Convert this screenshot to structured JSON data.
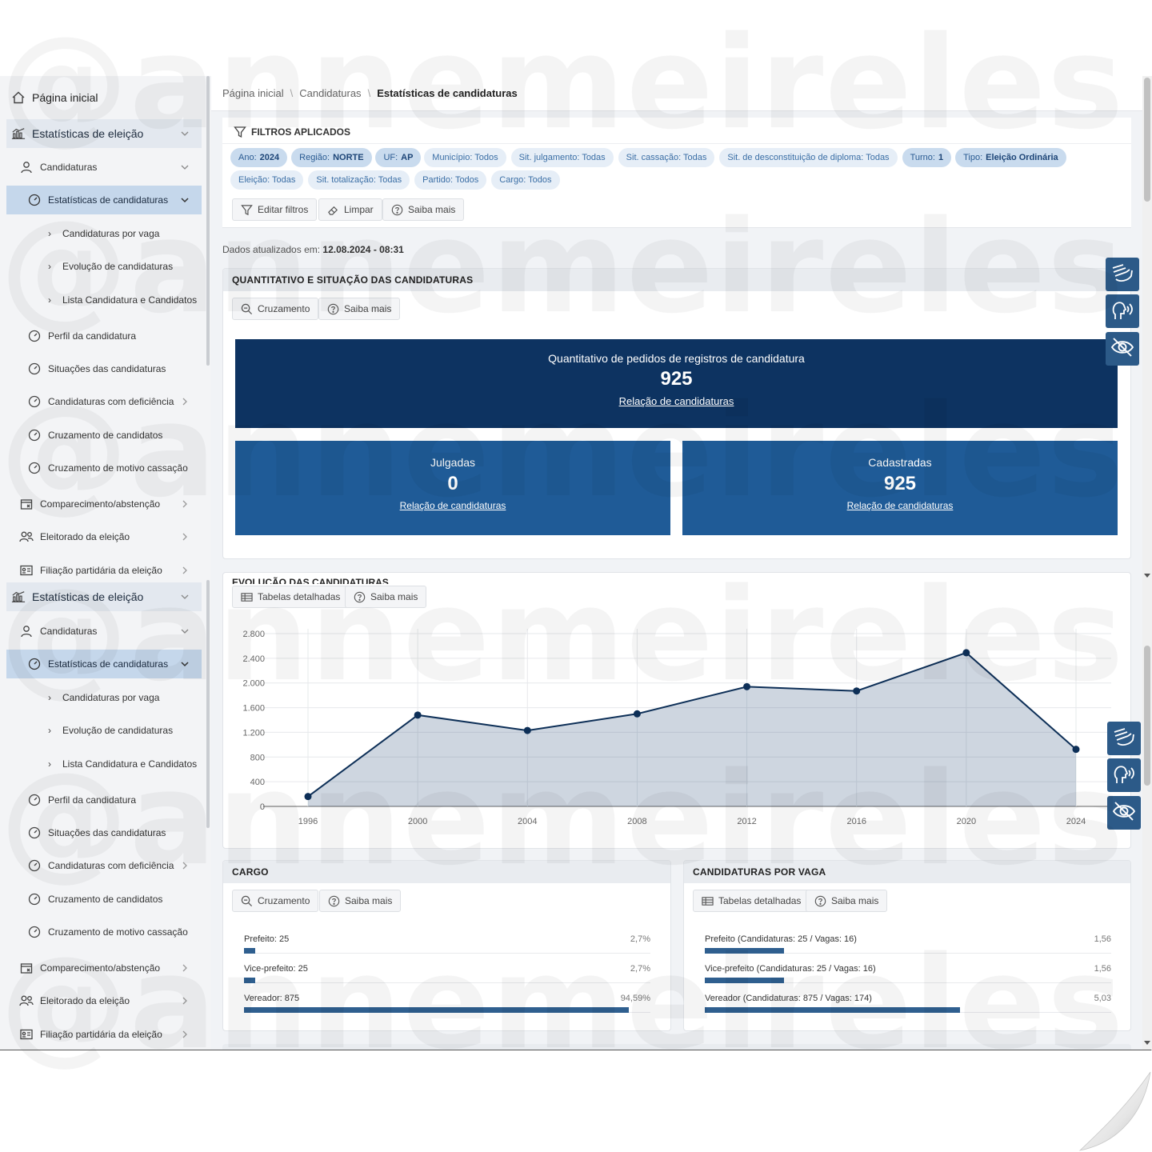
{
  "sidebar": {
    "home": "Página inicial",
    "section": "Estatísticas de eleição",
    "candidaturas": "Candidaturas",
    "estatisticas": "Estatísticas de candidaturas",
    "sub": [
      "Candidaturas por vaga",
      "Evolução de candidaturas",
      "Lista Candidatura e Candidatos"
    ],
    "items": [
      "Perfil da candidatura",
      "Situações das candidaturas",
      "Candidaturas com deficiência",
      "Cruzamento de candidatos",
      "Cruzamento de motivo cassação"
    ],
    "groups": [
      "Comparecimento/abstenção",
      "Eleitorado da eleição",
      "Filiação partidária da eleição"
    ]
  },
  "breadcrumb": {
    "home": "Página inicial",
    "mid": "Candidaturas",
    "current": "Estatísticas de candidaturas"
  },
  "filters": {
    "title": "FILTROS APLICADOS",
    "chips": [
      {
        "label": "Ano:",
        "value": "2024",
        "hl": true
      },
      {
        "label": "Região:",
        "value": "NORTE",
        "hl": true
      },
      {
        "label": "UF:",
        "value": "AP",
        "hl": true
      },
      {
        "label": "Município: Todos",
        "value": "",
        "hl": false
      },
      {
        "label": "Sit. julgamento: Todas",
        "value": "",
        "hl": false
      },
      {
        "label": "Sit. cassação: Todas",
        "value": "",
        "hl": false
      },
      {
        "label": "Sit. de desconstituição de diploma: Todas",
        "value": "",
        "hl": false
      },
      {
        "label": "Turno:",
        "value": "1",
        "hl": true
      },
      {
        "label": "Tipo:",
        "value": "Eleição Ordinária",
        "hl": true
      },
      {
        "label": "Eleição: Todas",
        "value": "",
        "hl": false
      },
      {
        "label": "Sit. totalização: Todas",
        "value": "",
        "hl": false
      },
      {
        "label": "Partido: Todos",
        "value": "",
        "hl": false
      },
      {
        "label": "Cargo: Todos",
        "value": "",
        "hl": false
      }
    ],
    "edit": "Editar filtros",
    "clear": "Limpar",
    "help": "Saiba mais"
  },
  "updated": {
    "label": "Dados atualizados em:",
    "value": "12.08.2024 - 08:31"
  },
  "quantitativo": {
    "title": "QUANTITATIVO E SITUAÇÃO DAS CANDIDATURAS",
    "cross": "Cruzamento",
    "help": "Saiba mais",
    "total_label": "Quantitativo de pedidos de registros de candidatura",
    "total": "925",
    "link": "Relação de candidaturas",
    "julgadas_label": "Julgadas",
    "julgadas": "0",
    "cadastradas_label": "Cadastradas",
    "cadastradas": "925"
  },
  "evolucao": {
    "title": "EVOLUÇÃO DAS CANDIDATURAS",
    "tables": "Tabelas detalhadas",
    "help": "Saiba mais"
  },
  "chart_data": {
    "type": "area",
    "x": [
      "1996",
      "2000",
      "2004",
      "2008",
      "2012",
      "2016",
      "2020",
      "2024"
    ],
    "values": [
      160,
      1480,
      1230,
      1500,
      1940,
      1870,
      2490,
      925
    ],
    "ylim": [
      0,
      2800
    ],
    "yticks": [
      "0",
      "400",
      "800",
      "1.200",
      "1.600",
      "2.000",
      "2.400",
      "2.800"
    ],
    "grid": true,
    "color": "#0d2f57"
  },
  "cargo": {
    "title": "CARGO",
    "cross": "Cruzamento",
    "help": "Saiba mais",
    "rows": [
      {
        "label": "Prefeito: 25",
        "pct": "2,7%",
        "frac": 0.027
      },
      {
        "label": "Vice-prefeito: 25",
        "pct": "2,7%",
        "frac": 0.027
      },
      {
        "label": "Vereador: 875",
        "pct": "94,59%",
        "frac": 0.9459
      }
    ]
  },
  "vaga": {
    "title": "CANDIDATURAS POR VAGA",
    "tables": "Tabelas detalhadas",
    "help": "Saiba mais",
    "rows": [
      {
        "label": "Prefeito (Candidaturas: 25 / Vagas: 16)",
        "value": "1,56",
        "num": 1.56
      },
      {
        "label": "Vice-prefeito (Candidaturas: 25 / Vagas: 16)",
        "value": "1,56",
        "num": 1.56
      },
      {
        "label": "Vereador (Candidaturas: 875 / Vagas: 174)",
        "value": "5,03",
        "num": 5.03
      }
    ]
  },
  "watermark": "@annemeireles",
  "colors": {
    "kpi_dark": "#0d3361",
    "kpi_mid": "#1f5b97",
    "accent": "#2c5a88"
  }
}
